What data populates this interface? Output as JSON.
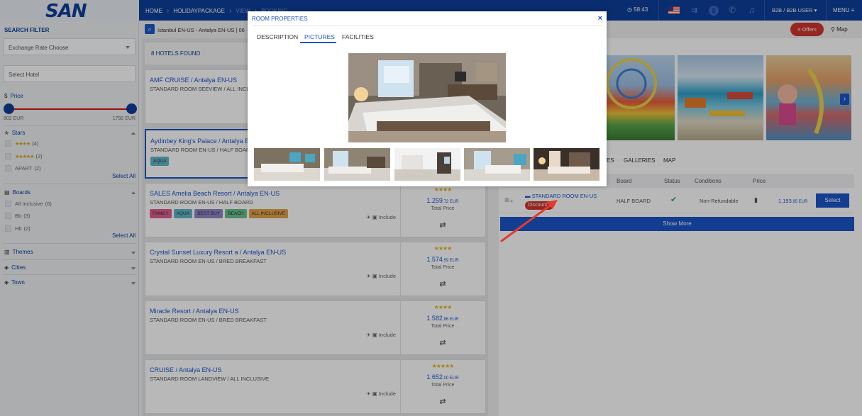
{
  "header": {
    "logo": "SAN",
    "crumbs": [
      "HOME",
      "HOLIDAYPACKAGE",
      "VIEW",
      "BOOKING"
    ],
    "timer": "58:43",
    "user": "B2B / B2B USER",
    "menu": "MENU"
  },
  "sidebar": {
    "title": "SEARCH FILTER",
    "exchange_placeholder": "Exchange Rate Choose",
    "hotel_placeholder": "Select Hotel",
    "price_label": "Price",
    "price_min": "802 EUR",
    "price_max": "1792 EUR",
    "stars_label": "Stars",
    "stars": [
      {
        "stars": "★★★★",
        "count": "(4)"
      },
      {
        "stars": "★★★★★",
        "count": "(2)"
      },
      {
        "stars": "APART",
        "count": "(2)"
      }
    ],
    "select_all": "Select All",
    "boards_label": "Boards",
    "boards": [
      {
        "label": "All Inclusive",
        "count": "(6)"
      },
      {
        "label": "Bb",
        "count": "(3)"
      },
      {
        "label": "Hb",
        "count": "(2)"
      }
    ],
    "themes_label": "Themes",
    "cities_label": "Cities",
    "town_label": "Town"
  },
  "search": {
    "summary": "Istanbul EN-US - Antalya EN-US | 06"
  },
  "results": {
    "found": "8 HOTELS FOUND",
    "include_label": "Include",
    "total_label": "Total Price",
    "hotels": [
      {
        "title": "AMF CRUISE / Antalya EN-US",
        "sub": "STANDARD ROOM SEEVIEW / ALL INCLUSIVE"
      },
      {
        "title": "Aydinbey King's Palace / Antalya EN-US",
        "sub": "STANDARD ROOM EN-US / HALF BOARD",
        "tag": "AQUA"
      },
      {
        "title": "SALES Amelia Beach Resort / Antalya EN-US",
        "sub": "STANDARD ROOM EN-US / HALF BOARD",
        "stars": "★★★★",
        "price": "1.259",
        "cents": ",72 EUR",
        "tags": [
          "FAMILY",
          "AQUA",
          "BEST BUY",
          "BEACH",
          "ALL INCLUSIVE"
        ]
      },
      {
        "title": "Crystal Sunset Luxury Resort a / Antalya EN-US",
        "sub": "STANDARD ROOM EN-US / BRED BREAKFAST",
        "stars": "★★★★",
        "price": "1.574",
        "cents": ",59 EUR"
      },
      {
        "title": "Miracle Resort / Antalya EN-US",
        "sub": "STANDARD ROOM EN-US / BRED BREAKFAST",
        "stars": "★★★★",
        "price": "1.582",
        "cents": ",86 EUR"
      },
      {
        "title": "CRUISE / Antalya EN-US",
        "sub": "STANDARD ROOM LANDVIEW / ALL INCLUSIVE",
        "stars": "★★★★★",
        "price": "1.652",
        "cents": ",00 EUR"
      }
    ]
  },
  "detail": {
    "offers": "Offers",
    "map": "Map",
    "tabs": [
      "ES",
      "GALLERIES",
      "MAP"
    ],
    "columns": [
      "Board",
      "Status",
      "Conditions",
      "Price"
    ],
    "room": {
      "name": "STANDARD ROOM EN-US",
      "badge": "Discount",
      "board": "HALF BOARD",
      "conditions": "Non-Refundable",
      "price": "1.193",
      "cents": ",95 EUR",
      "select": "Select"
    },
    "show_more": "Show More"
  },
  "modal": {
    "title": "ROOM PROPERTIES",
    "close": "×",
    "tabs": [
      "DESCRIPTION",
      "PICTURES",
      "FACILITIES"
    ]
  }
}
